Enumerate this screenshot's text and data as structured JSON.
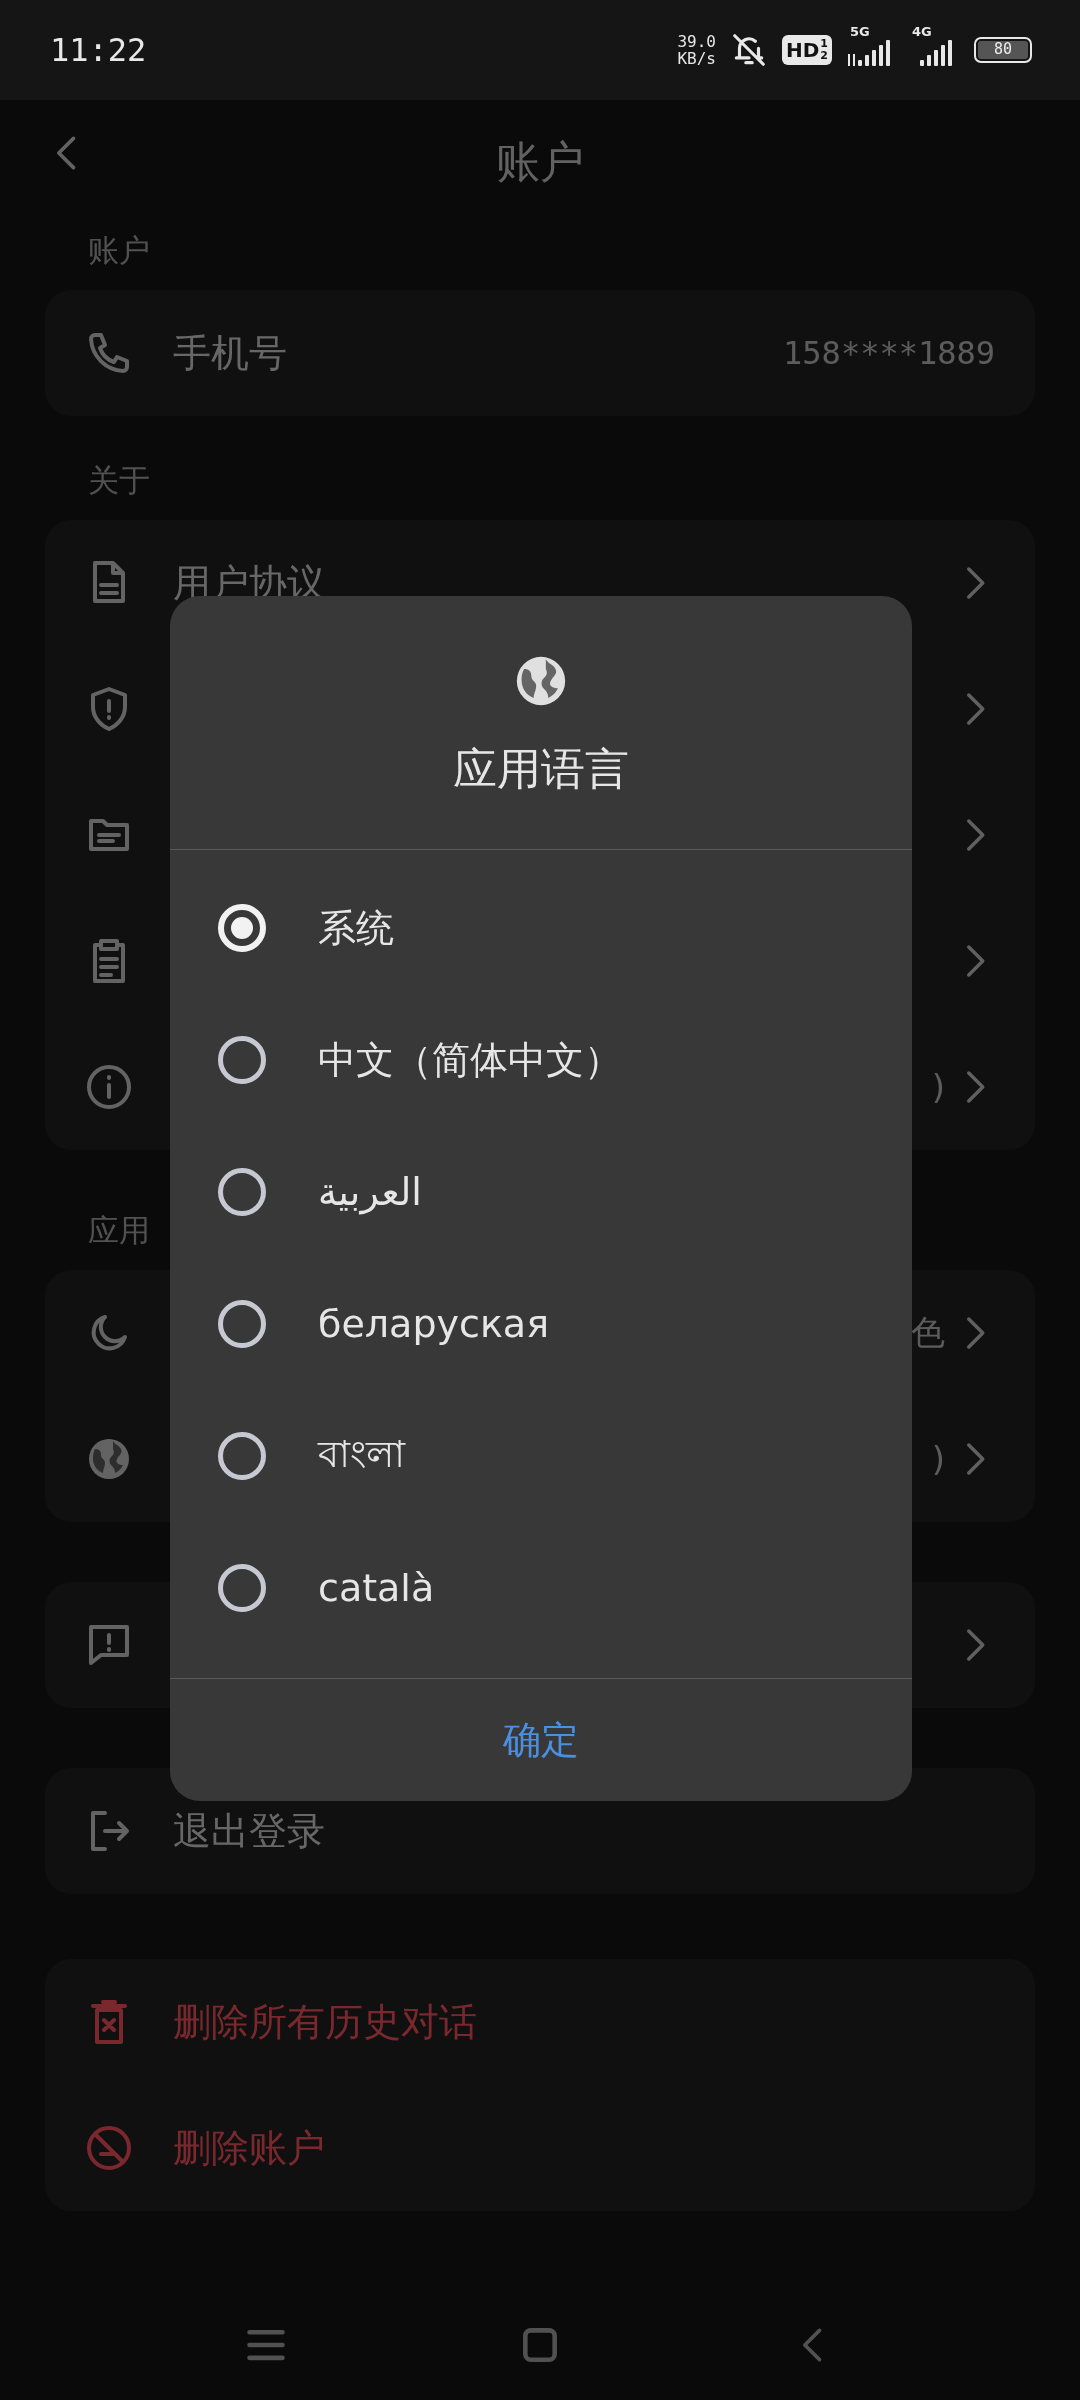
{
  "status_bar": {
    "time": "11:22",
    "net_speed": "39.0",
    "net_unit": "KB/s",
    "hd_badge": {
      "label": "HD",
      "sup": "1",
      "sub": "2"
    },
    "sim_1": "5G",
    "sim_2": "4G",
    "battery": "80"
  },
  "header": {
    "title": "账户"
  },
  "sections": [
    {
      "label": "账户",
      "rows": [
        {
          "kind": "value",
          "label": "手机号",
          "value": "158****1889"
        }
      ]
    },
    {
      "label": "关于",
      "rows": [
        {
          "kind": "nav",
          "label": "用户协议"
        },
        {
          "kind": "nav"
        },
        {
          "kind": "nav"
        },
        {
          "kind": "nav"
        },
        {
          "kind": "nav",
          "value": ")"
        }
      ]
    },
    {
      "label": "应用",
      "rows": [
        {
          "kind": "nav",
          "value": "色"
        },
        {
          "kind": "nav",
          "value": ")"
        }
      ]
    },
    {
      "rows": [
        {
          "kind": "nav"
        }
      ]
    },
    {
      "rows": [
        {
          "kind": "plain",
          "label": "退出登录"
        }
      ]
    },
    {
      "rows": [
        {
          "kind": "danger",
          "label": "删除所有历史对话"
        },
        {
          "kind": "danger",
          "label": "删除账户"
        }
      ]
    }
  ],
  "dialog": {
    "title": "应用语言",
    "options": [
      {
        "label": "系统",
        "selected": true
      },
      {
        "label": "中文（简体中文）",
        "selected": false
      },
      {
        "label": "العربية",
        "selected": false
      },
      {
        "label": "беларуская",
        "selected": false
      },
      {
        "label": "বাংলা",
        "selected": false
      },
      {
        "label": "català",
        "selected": false
      }
    ],
    "confirm": "确定"
  }
}
